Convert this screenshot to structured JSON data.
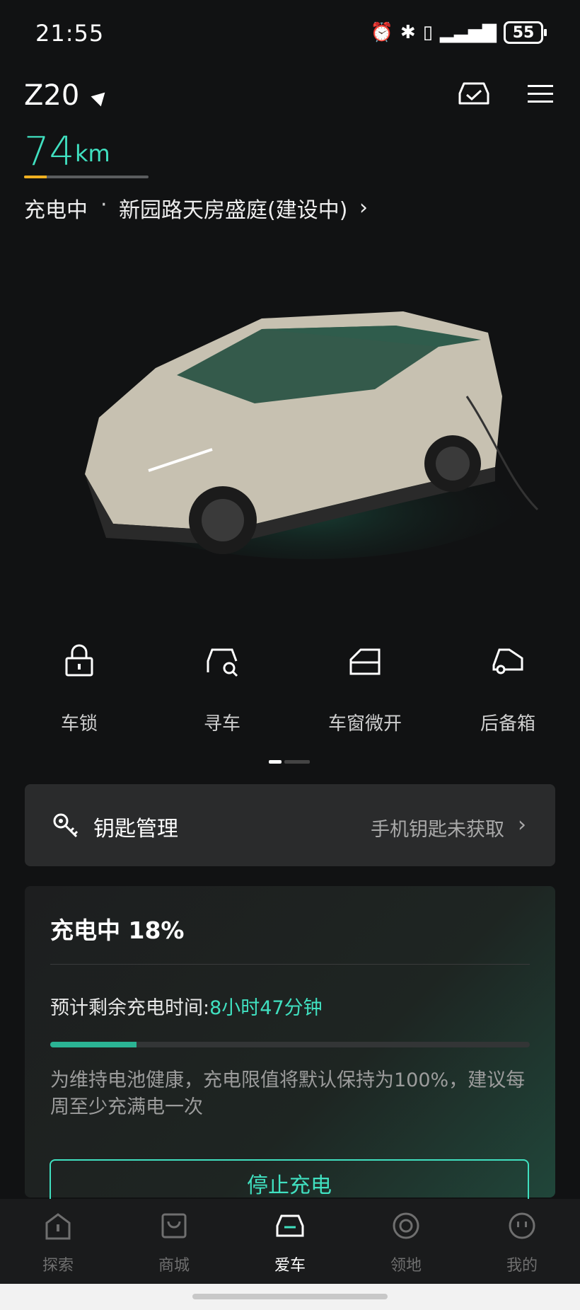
{
  "status_bar": {
    "time": "21:55",
    "battery": "55"
  },
  "header": {
    "model": "Z20"
  },
  "range": {
    "value": "74",
    "unit": "km",
    "level": 0.18
  },
  "charge_line": {
    "status": "充电中",
    "separator": "·",
    "location": "新园路天房盛庭(建设中)"
  },
  "quick_actions": [
    {
      "label": "车锁",
      "icon": "lock-icon"
    },
    {
      "label": "寻车",
      "icon": "find-car-icon"
    },
    {
      "label": "车窗微开",
      "icon": "window-icon"
    },
    {
      "label": "后备箱",
      "icon": "trunk-icon"
    }
  ],
  "key_card": {
    "title": "钥匙管理",
    "status": "手机钥匙未获取"
  },
  "charging_card": {
    "title": "充电中 18%",
    "remaining_label": "预计剩余充电时间:",
    "remaining_value": "8小时47分钟",
    "progress": 0.18,
    "note": "为维持电池健康，充电限值将默认保持为100%，建议每周至少充满电一次",
    "stop_button": "停止充电"
  },
  "bottom_nav": [
    {
      "label": "探索",
      "icon": "explore-icon",
      "active": false
    },
    {
      "label": "商城",
      "icon": "shop-icon",
      "active": false
    },
    {
      "label": "爱车",
      "icon": "car-icon",
      "active": true
    },
    {
      "label": "领地",
      "icon": "territory-icon",
      "active": false
    },
    {
      "label": "我的",
      "icon": "profile-icon",
      "active": false
    }
  ],
  "colors": {
    "accent": "#40e0c0",
    "range_bar": "#f0b020",
    "background": "#111213"
  }
}
